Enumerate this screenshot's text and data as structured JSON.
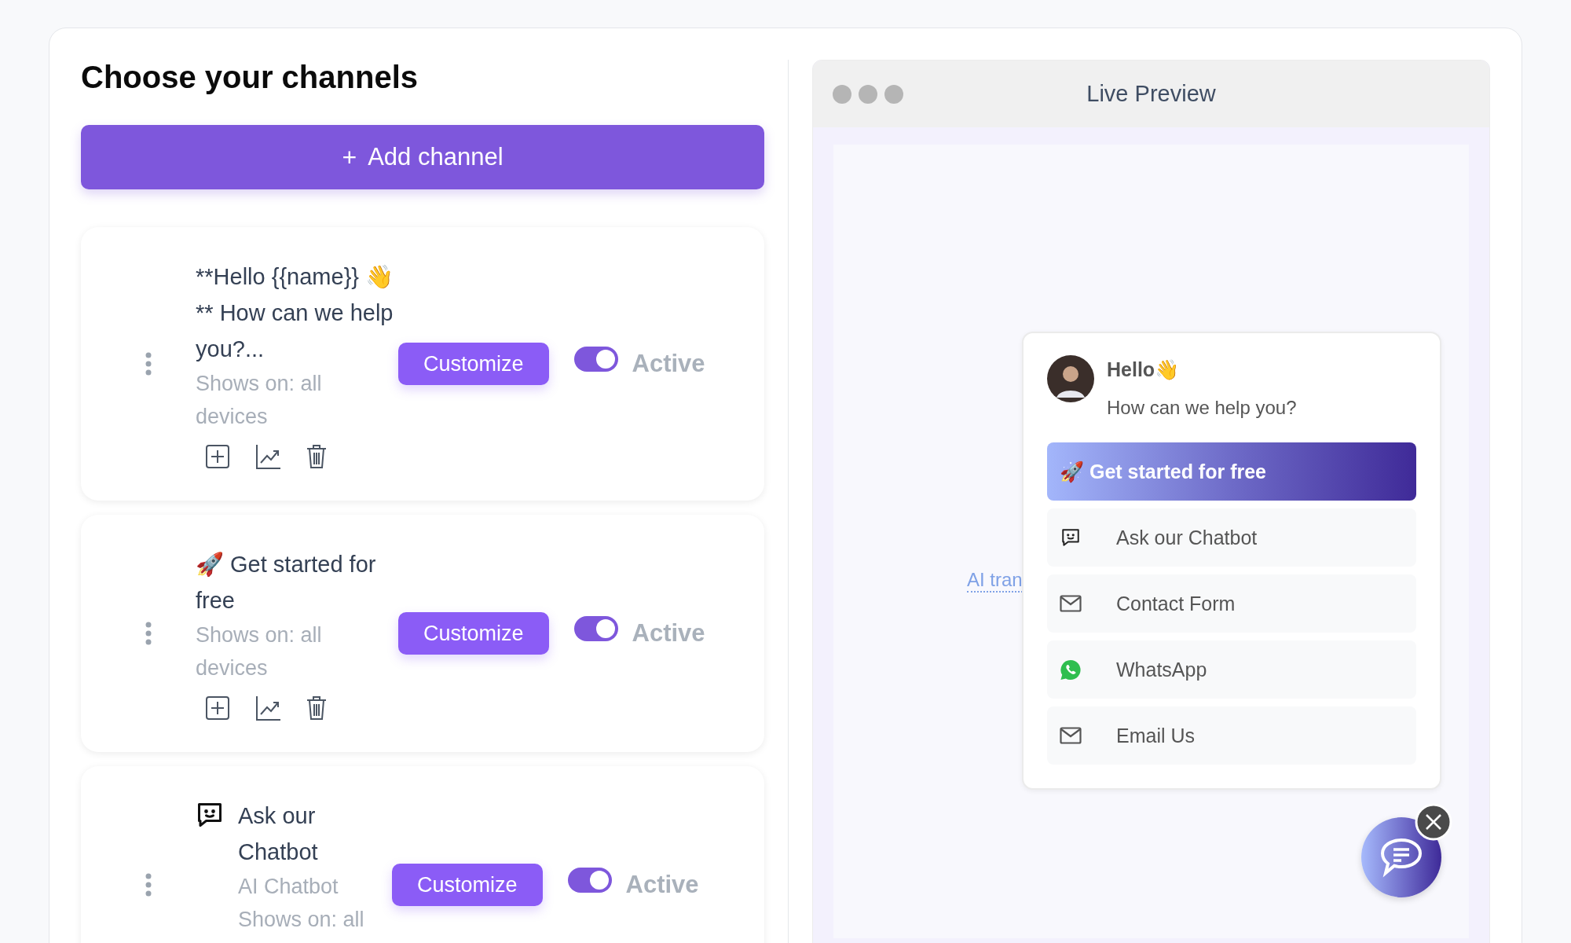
{
  "title": "Choose your channels",
  "add_button": {
    "icon": "+",
    "label": "Add channel"
  },
  "channels": [
    {
      "kind": "text",
      "title": "**Hello {{name}} 👋 ** How can we help you?...",
      "shows_on": "Shows on: all devices",
      "button": "Customize",
      "enabled": true,
      "status": "Active"
    },
    {
      "kind": "text",
      "title": "🚀 Get started for free",
      "shows_on": "Shows on: all devices",
      "button": "Customize",
      "enabled": true,
      "status": "Active"
    },
    {
      "kind": "chatbot",
      "title": "Ask our Chatbot",
      "subtitle": "AI Chatbot",
      "shows_on": "Shows on: all",
      "button": "Customize",
      "enabled": true,
      "status": "Active"
    }
  ],
  "preview": {
    "title": "Live Preview",
    "link": "AI tran",
    "widget": {
      "greeting": "Hello👋",
      "message": "How can we help you?",
      "options": [
        {
          "kind": "primary",
          "label": "🚀 Get started for free"
        },
        {
          "kind": "chatbot",
          "label": "Ask our Chatbot"
        },
        {
          "kind": "mail",
          "label": "Contact Form"
        },
        {
          "kind": "whatsapp",
          "label": "WhatsApp"
        },
        {
          "kind": "mail",
          "label": "Email Us"
        }
      ]
    }
  }
}
